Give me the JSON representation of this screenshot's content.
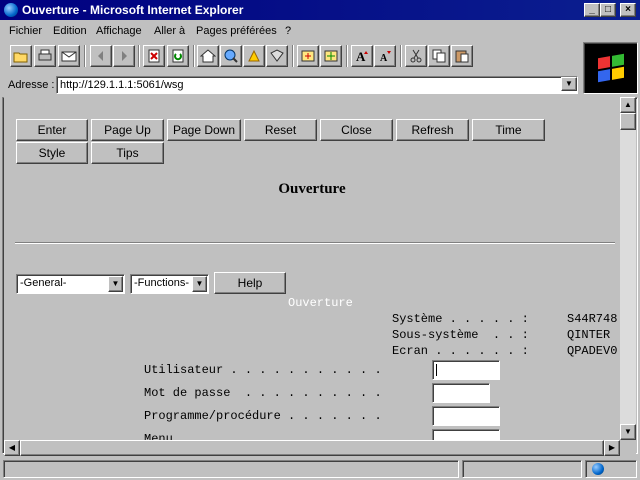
{
  "window": {
    "title": "Ouverture - Microsoft Internet Explorer",
    "buttons": {
      "minimize": "_",
      "maximize": "□",
      "close": "×"
    }
  },
  "menu": [
    {
      "label": "Fichier"
    },
    {
      "label": "Edition"
    },
    {
      "label": "Affichage"
    },
    {
      "label": "Aller à"
    },
    {
      "label": "Pages préférées"
    },
    {
      "label": "?"
    }
  ],
  "toolbar": {
    "icons": [
      "open-folder-icon",
      "print-icon",
      "mail-icon",
      "back-icon",
      "forward-icon",
      "stop-icon",
      "refresh-icon",
      "home-icon",
      "search-icon",
      "favorites-icon",
      "history-icon",
      "channels-icon",
      "favorites-add-icon",
      "font-larger-icon",
      "font-smaller-icon",
      "cut-icon",
      "copy-icon",
      "paste-icon"
    ]
  },
  "address": {
    "label": "Adresse :",
    "url": "http://129.1.1.1:5061/wsg"
  },
  "page": {
    "buttons_row1": [
      "Enter",
      "Page Up",
      "Page Down",
      "Reset",
      "Close",
      "Refresh",
      "Time"
    ],
    "buttons_row2": [
      "Style",
      "Tips"
    ],
    "heading": "Ouverture",
    "select_general": "-General-",
    "select_functions": "-Functions-",
    "help_button": "Help",
    "screen_title": "Ouverture",
    "system_info": [
      {
        "label": "Système . . . . . :",
        "value": "S44R748"
      },
      {
        "label": "Sous-système  . . :",
        "value": "QINTER"
      },
      {
        "label": "Ecran . . . . . . :",
        "value": "QPADEV0"
      }
    ],
    "fields": [
      {
        "label": "Utilisateur . . . . . . . . . . .",
        "value": ""
      },
      {
        "label": "Mot de passe  . . . . . . . . . .",
        "value": ""
      },
      {
        "label": "Programme/procédure . . . . . . .",
        "value": ""
      },
      {
        "label": "Menu",
        "value": ""
      }
    ]
  },
  "colors": {
    "titlebar": "#000080",
    "dialog_gray": "#c0c0c0",
    "screen_title_color": "#ffffff"
  }
}
